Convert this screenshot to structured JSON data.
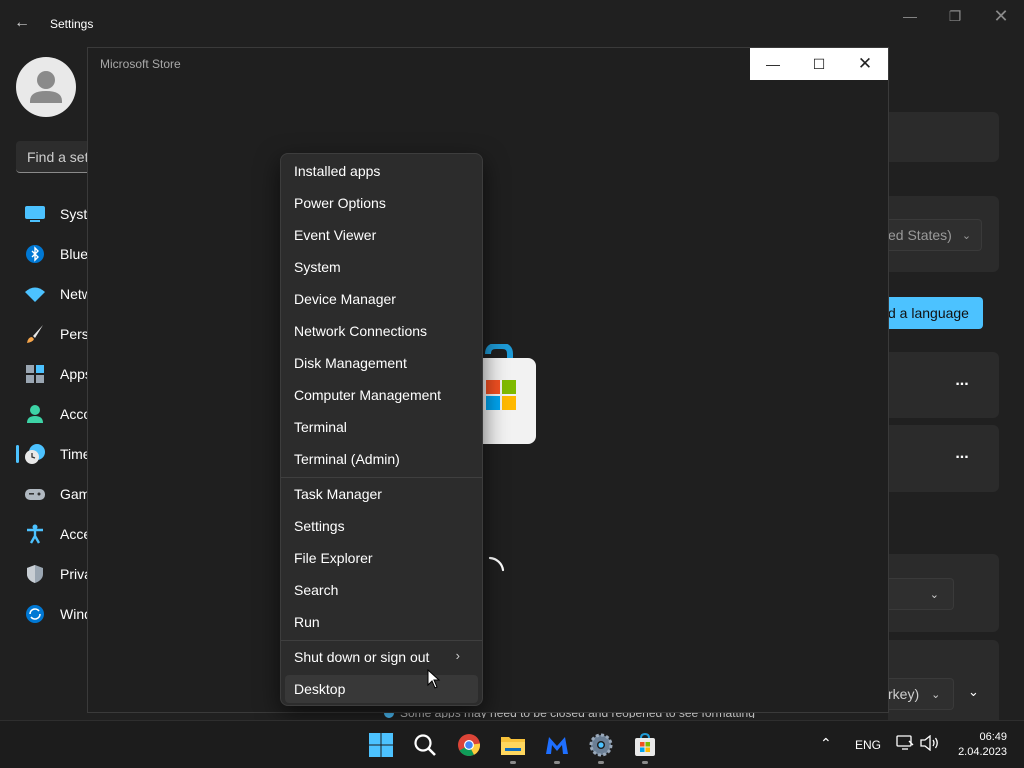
{
  "settings": {
    "title": "Settings",
    "search_placeholder": "Find a setting",
    "nav": [
      {
        "label": "System",
        "icon": "monitor-icon"
      },
      {
        "label": "Bluetooth & devices",
        "icon": "bluetooth-icon"
      },
      {
        "label": "Network & internet",
        "icon": "wifi-icon"
      },
      {
        "label": "Personalization",
        "icon": "brush-icon"
      },
      {
        "label": "Apps",
        "icon": "apps-icon"
      },
      {
        "label": "Accounts",
        "icon": "person-icon"
      },
      {
        "label": "Time & language",
        "icon": "clock-globe-icon"
      },
      {
        "label": "Gaming",
        "icon": "gamepad-icon"
      },
      {
        "label": "Accessibility",
        "icon": "accessibility-icon"
      },
      {
        "label": "Privacy & security",
        "icon": "shield-icon"
      },
      {
        "label": "Windows Update",
        "icon": "update-icon"
      }
    ],
    "region_dropdown": "ed States)",
    "add_language_button": "d a language",
    "more_options": "...",
    "regional_format_dropdown": "rkey)",
    "footer_note": "Some apps may need to be closed and reopened to see formatting"
  },
  "store": {
    "title": "Microsoft Store"
  },
  "context_menu": {
    "items": [
      "Installed apps",
      "Power Options",
      "Event Viewer",
      "System",
      "Device Manager",
      "Network Connections",
      "Disk Management",
      "Computer Management",
      "Terminal",
      "Terminal (Admin)",
      "Task Manager",
      "Settings",
      "File Explorer",
      "Search",
      "Run",
      "Shut down or sign out",
      "Desktop"
    ]
  },
  "taskbar": {
    "language": "ENG",
    "time": "06:49",
    "date": "2.04.2023"
  }
}
